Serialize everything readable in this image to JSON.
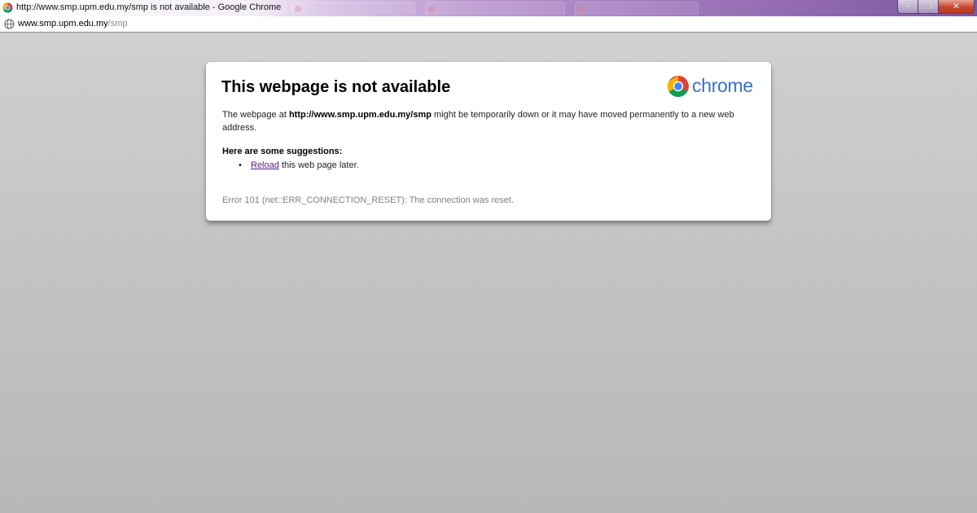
{
  "window": {
    "title": "http://www.smp.upm.edu.my/smp is not available - Google Chrome",
    "controls": {
      "minimize_glyph": "–",
      "maximize_glyph": "❐",
      "close_glyph": "✕"
    },
    "icons": {
      "favicon": "chrome-favicon-icon",
      "minimize": "minimize-icon",
      "maximize": "restore-icon",
      "close": "close-icon"
    }
  },
  "address_bar": {
    "host": "www.smp.upm.edu.my",
    "path": "/smp",
    "icon": "globe-icon"
  },
  "error_page": {
    "title": "This webpage is not available",
    "logo_text": "chrome",
    "logo_icon": "chrome-logo-icon",
    "message_prefix": "The webpage at ",
    "message_url": "http://www.smp.upm.edu.my/smp",
    "message_suffix": " might be temporarily down or it may have moved permanently to a new web address.",
    "suggestions_heading": "Here are some suggestions:",
    "suggestions": [
      {
        "bullet": "•",
        "link_text": "Reload",
        "rest_text": " this web page later."
      }
    ],
    "error_code": "Error 101 (net::ERR_CONNECTION_RESET): The connection was reset."
  },
  "colors": {
    "titlebar_accent": "#7e56a3",
    "page_background": "#c4c4c4",
    "link_visited": "#551a8b",
    "chrome_wordmark": "#3a6fd6",
    "error_code_text": "#808080"
  }
}
